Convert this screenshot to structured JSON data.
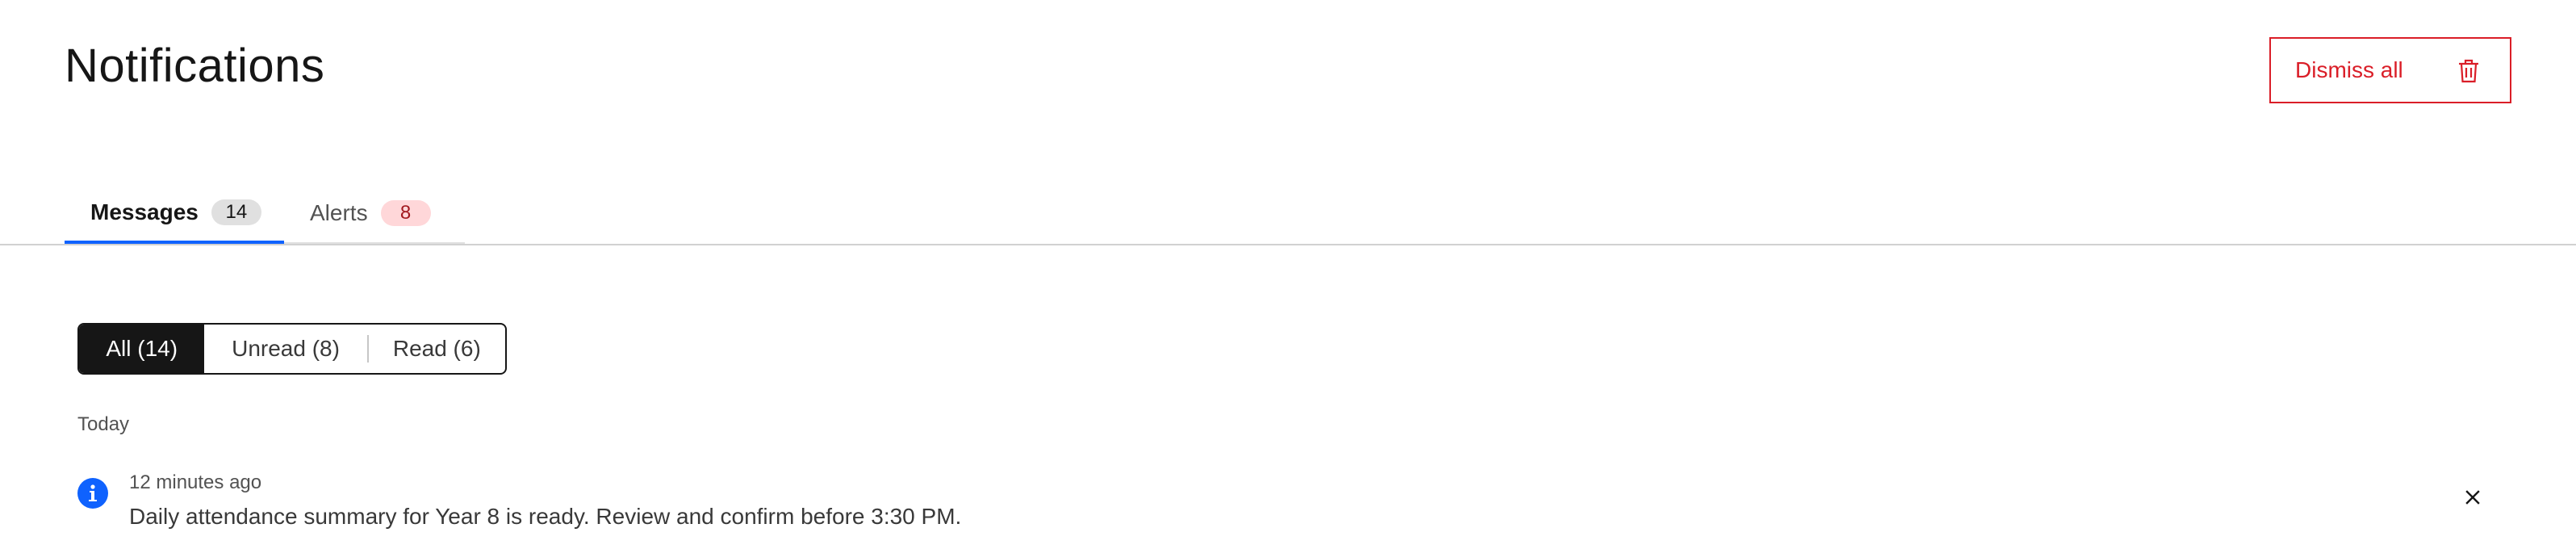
{
  "header": {
    "title": "Notifications",
    "dismiss_all_label": "Dismiss all",
    "dismiss_icon": "trash-icon",
    "accent_color": "#da1e28"
  },
  "tabs": [
    {
      "label": "Messages",
      "count": "14",
      "selected": true
    },
    {
      "label": "Alerts",
      "count": "8",
      "selected": false
    }
  ],
  "filter": {
    "options": [
      {
        "label": "All (14)",
        "selected": true
      },
      {
        "label": "Unread (8)",
        "selected": false
      },
      {
        "label": "Read (6)",
        "selected": false
      }
    ]
  },
  "sections": [
    {
      "label": "Today",
      "items": [
        {
          "icon": "info-icon",
          "time": "12 minutes ago",
          "message": "Daily attendance summary for Year 8 is ready. Review and confirm before 3:30 PM.",
          "close_icon": "close-icon"
        }
      ]
    }
  ],
  "colors": {
    "tab_active_indicator": "#0f62fe",
    "info_icon": "#0f62fe",
    "alert_badge_bg": "#ffd7d9",
    "selected_filter_bg": "#161616"
  }
}
